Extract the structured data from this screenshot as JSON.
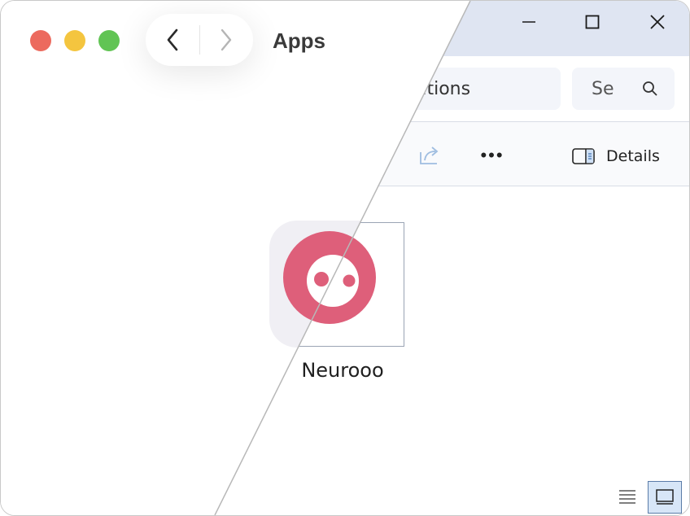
{
  "window": {
    "mac_title": "Apps",
    "address_fragment": "ations",
    "search_placeholder": "Se",
    "details_label": "Details",
    "more_label": "•••"
  },
  "file": {
    "name": "Neurooo"
  },
  "icons": {
    "back": "chevron-left-icon",
    "forward": "chevron-right-icon",
    "minimize": "minimize-icon",
    "maximize": "maximize-icon",
    "close": "close-icon",
    "search": "search-icon",
    "share": "share-icon",
    "details": "details-pane-icon",
    "list_view": "list-view-icon",
    "tiles_view": "tiles-view-icon"
  },
  "colors": {
    "mac_close": "#ec6a5e",
    "mac_minimize": "#f4c53f",
    "mac_zoom": "#61c454",
    "app_brand": "#de5f7a",
    "win_titlebar": "#dfe5f2"
  }
}
